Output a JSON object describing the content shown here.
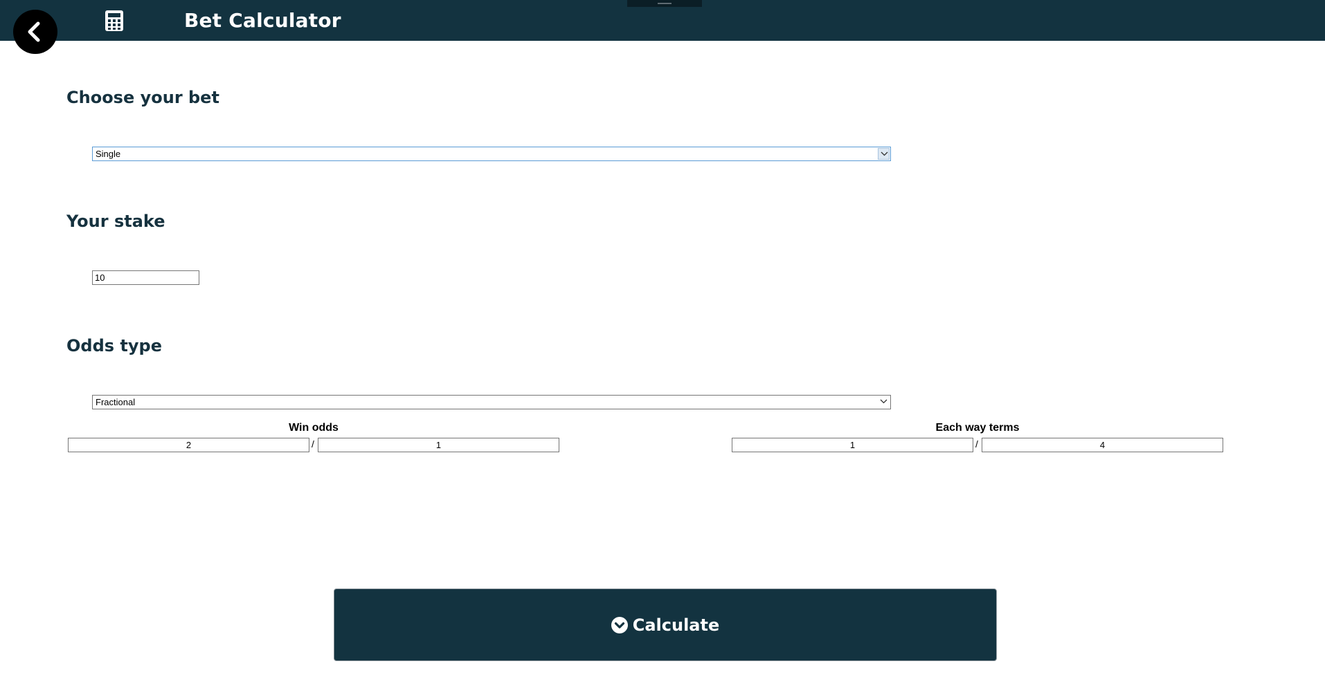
{
  "header": {
    "title": "Bet Calculator",
    "back_icon": "chevron-left-icon",
    "app_icon": "calculator-icon"
  },
  "bet_section": {
    "heading": "Choose your bet",
    "selected": "Single"
  },
  "stake_section": {
    "heading": "Your stake",
    "value": "10"
  },
  "odds_section": {
    "heading": "Odds type",
    "selected": "Fractional"
  },
  "win_odds": {
    "label": "Win odds",
    "numerator": "2",
    "separator": "/",
    "denominator": "1"
  },
  "each_way": {
    "label": "Each way terms",
    "numerator": "1",
    "separator": "/",
    "denominator": "4"
  },
  "calculate_button": {
    "label": "Calculate",
    "icon": "chevron-down-circle-icon"
  },
  "colors": {
    "header_bg": "#133340",
    "heading_text": "#16323f",
    "button_bg": "#133340"
  }
}
